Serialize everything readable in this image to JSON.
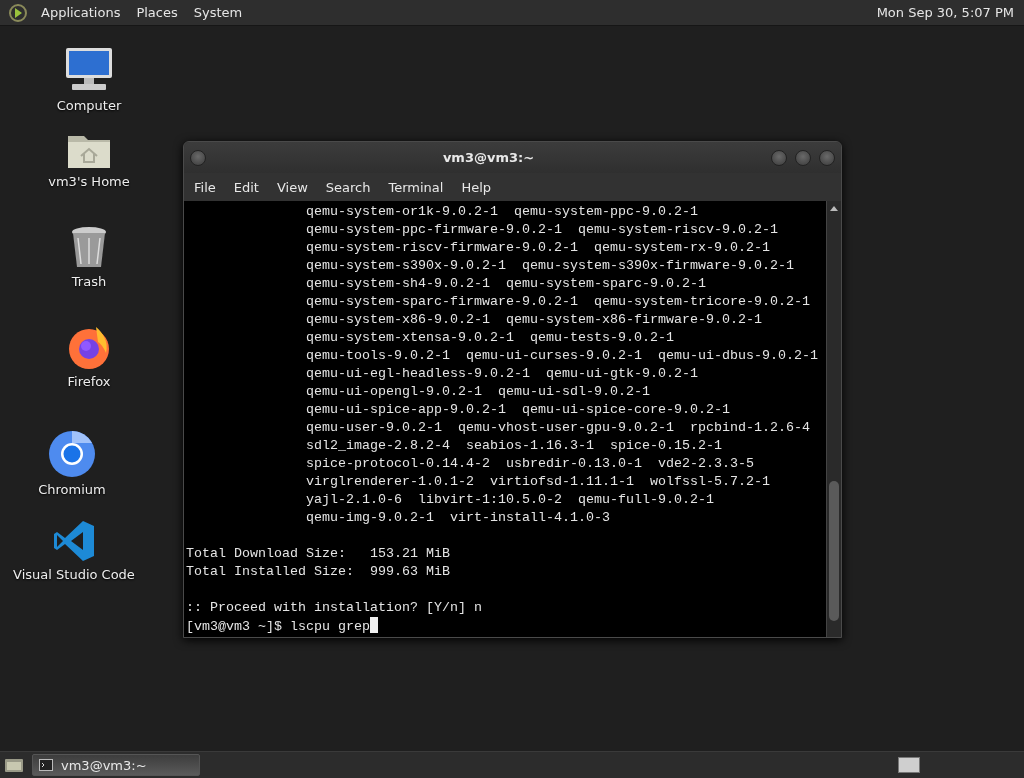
{
  "top_panel": {
    "menus": [
      "Applications",
      "Places",
      "System"
    ],
    "clock": "Mon Sep 30, 5:07 PM"
  },
  "desktop_icons": [
    {
      "kind": "computer",
      "label": "Computer"
    },
    {
      "kind": "home",
      "label": "vm3's Home"
    },
    {
      "kind": "trash",
      "label": "Trash"
    },
    {
      "kind": "firefox",
      "label": "Firefox"
    },
    {
      "kind": "chromium",
      "label": "Chromium"
    },
    {
      "kind": "vscode",
      "label": "Visual Studio Code"
    }
  ],
  "terminal": {
    "title": "vm3@vm3:~",
    "menus": [
      "File",
      "Edit",
      "View",
      "Search",
      "Terminal",
      "Help"
    ],
    "lines": [
      {
        "kind": "package",
        "text": "qemu-system-or1k-9.0.2-1  qemu-system-ppc-9.0.2-1"
      },
      {
        "kind": "package",
        "text": "qemu-system-ppc-firmware-9.0.2-1  qemu-system-riscv-9.0.2-1"
      },
      {
        "kind": "package",
        "text": "qemu-system-riscv-firmware-9.0.2-1  qemu-system-rx-9.0.2-1"
      },
      {
        "kind": "package",
        "text": "qemu-system-s390x-9.0.2-1  qemu-system-s390x-firmware-9.0.2-1"
      },
      {
        "kind": "package",
        "text": "qemu-system-sh4-9.0.2-1  qemu-system-sparc-9.0.2-1"
      },
      {
        "kind": "package",
        "text": "qemu-system-sparc-firmware-9.0.2-1  qemu-system-tricore-9.0.2-1"
      },
      {
        "kind": "package",
        "text": "qemu-system-x86-9.0.2-1  qemu-system-x86-firmware-9.0.2-1"
      },
      {
        "kind": "package",
        "text": "qemu-system-xtensa-9.0.2-1  qemu-tests-9.0.2-1"
      },
      {
        "kind": "package",
        "text": "qemu-tools-9.0.2-1  qemu-ui-curses-9.0.2-1  qemu-ui-dbus-9.0.2-1"
      },
      {
        "kind": "package",
        "text": "qemu-ui-egl-headless-9.0.2-1  qemu-ui-gtk-9.0.2-1"
      },
      {
        "kind": "package",
        "text": "qemu-ui-opengl-9.0.2-1  qemu-ui-sdl-9.0.2-1"
      },
      {
        "kind": "package",
        "text": "qemu-ui-spice-app-9.0.2-1  qemu-ui-spice-core-9.0.2-1"
      },
      {
        "kind": "package",
        "text": "qemu-user-9.0.2-1  qemu-vhost-user-gpu-9.0.2-1  rpcbind-1.2.6-4"
      },
      {
        "kind": "package",
        "text": "sdl2_image-2.8.2-4  seabios-1.16.3-1  spice-0.15.2-1"
      },
      {
        "kind": "package",
        "text": "spice-protocol-0.14.4-2  usbredir-0.13.0-1  vde2-2.3.3-5"
      },
      {
        "kind": "package",
        "text": "virglrenderer-1.0.1-2  virtiofsd-1.11.1-1  wolfssl-5.7.2-1"
      },
      {
        "kind": "package",
        "text": "yajl-2.1.0-6  libvirt-1:10.5.0-2  qemu-full-9.0.2-1"
      },
      {
        "kind": "package",
        "text": "qemu-img-9.0.2-1  virt-install-4.1.0-3"
      },
      {
        "kind": "blank"
      },
      {
        "kind": "output",
        "text": "Total Download Size:   153.21 MiB"
      },
      {
        "kind": "output",
        "text": "Total Installed Size:  999.63 MiB"
      },
      {
        "kind": "blank"
      },
      {
        "kind": "output",
        "text": ":: Proceed with installation? [Y/n] n"
      },
      {
        "kind": "prompt",
        "text": "[vm3@vm3 ~]$ lscpu grep"
      }
    ]
  },
  "taskbar": {
    "tasks": [
      {
        "label": "vm3@vm3:~",
        "selected": true
      }
    ]
  }
}
